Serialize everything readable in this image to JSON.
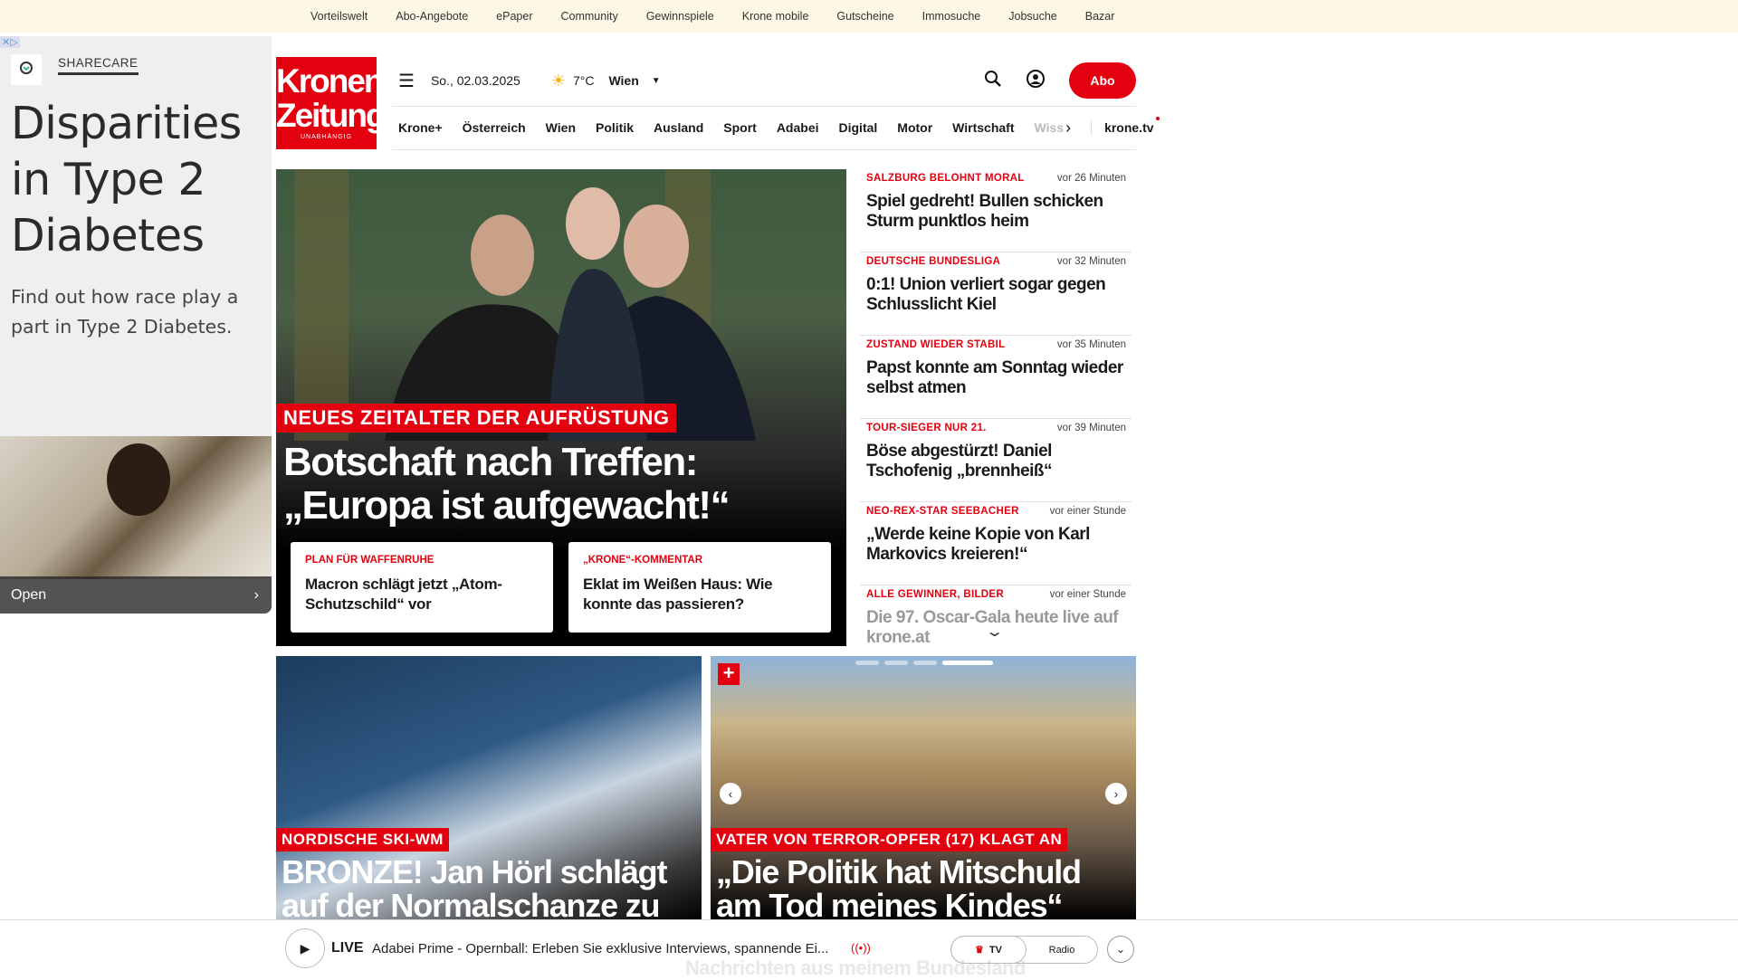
{
  "topbar": [
    "Vorteilswelt",
    "Abo-Angebote",
    "ePaper",
    "Community",
    "Gewinnspiele",
    "Krone mobile",
    "Gutscheine",
    "Immosuche",
    "Jobsuche",
    "Bazar"
  ],
  "ad": {
    "brand": "SHARECARE",
    "headline": "Disparities in Type 2 Diabetes",
    "body": "Find out how race play a part in Type 2 Diabetes.",
    "cta": "Open"
  },
  "logo": {
    "line1": "Kronen",
    "line2": "Zeitung",
    "tagline": "UNABHÄNGIG"
  },
  "header": {
    "date": "So., 02.03.2025",
    "temp": "7°C",
    "city": "Wien",
    "abo": "Abo"
  },
  "nav": [
    "Krone+",
    "Österreich",
    "Wien",
    "Politik",
    "Ausland",
    "Sport",
    "Adabei",
    "Digital",
    "Motor",
    "Wirtschaft"
  ],
  "nav_partial": "Wiss",
  "nav_tv": "krone.tv",
  "hero": {
    "kicker": "NEUES ZEITALTER DER AUFRÜSTUNG",
    "title": "Botschaft nach Treffen: „Europa ist aufgewacht!“",
    "sub": [
      {
        "kicker": "PLAN FÜR WAFFENRUHE",
        "title": "Macron schlägt jetzt „Atom-Schutzschild“ vor"
      },
      {
        "kicker": "„KRONE“-KOMMENTAR",
        "title": "Eklat im Weißen Haus: Wie konnte das passieren?"
      }
    ]
  },
  "news": [
    {
      "kicker": "SALZBURG BELOHNT MORAL",
      "time": "vor 26 Minuten",
      "title": "Spiel gedreht! Bullen schicken Sturm punktlos heim"
    },
    {
      "kicker": "DEUTSCHE BUNDESLIGA",
      "time": "vor 32 Minuten",
      "title": "0:1! Union verliert sogar gegen Schlusslicht Kiel"
    },
    {
      "kicker": "ZUSTAND WIEDER STABIL",
      "time": "vor 35 Minuten",
      "title": "Papst konnte am Sonntag wieder selbst atmen"
    },
    {
      "kicker": "TOUR-SIEGER NUR 21.",
      "time": "vor 39 Minuten",
      "title": "Böse abgestürzt! Daniel Tschofenig „brennheiß“"
    },
    {
      "kicker": "NEO-REX-STAR SEEBACHER",
      "time": "vor einer Stunde",
      "title": "„Werde keine Kopie von Karl Markovics kreieren!“"
    },
    {
      "kicker": "ALLE GEWINNER, BILDER",
      "time": "vor einer Stunde",
      "title": "Die 97. Oscar-Gala heute live auf krone.at"
    }
  ],
  "cards": [
    {
      "kicker": "NORDISCHE SKI-WM",
      "title": "BRONZE! Jan Hörl schlägt auf der Normalschanze zu"
    },
    {
      "kicker": "VATER VON TERROR-OPFER (17) KLAGT AN",
      "title": "„Die Politik hat Mitschuld am Tod meines Kindes“"
    }
  ],
  "player": {
    "live": "LIVE",
    "text": "Adabei Prime - Opernball: Erleben Sie exklusive Interviews, spannende Ei...",
    "tv": "TV",
    "radio": "Radio",
    "below": "Nachrichten aus meinem Bundesland"
  }
}
